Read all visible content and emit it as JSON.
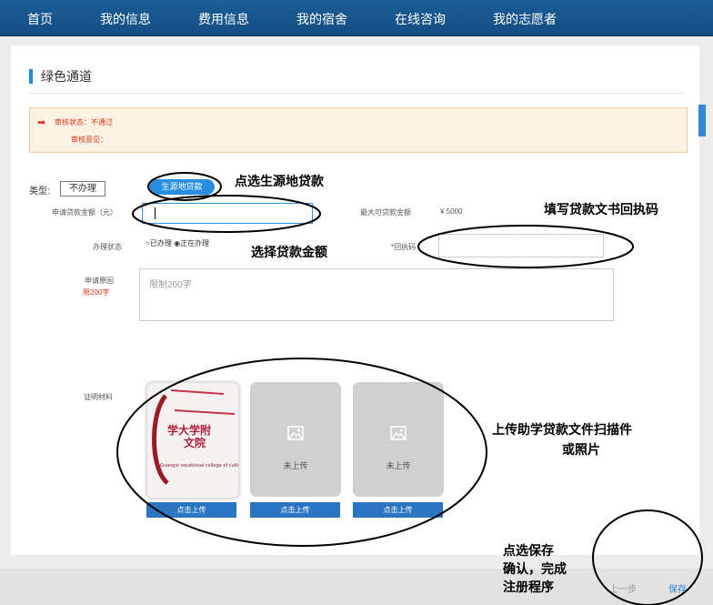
{
  "nav": {
    "items": [
      "首页",
      "我的信息",
      "费用信息",
      "我的宿舍",
      "在线咨询",
      "我的志愿者"
    ]
  },
  "section": {
    "title": "绿色通道"
  },
  "alert": {
    "status": "审核状态：不通过",
    "comment": "审核意见："
  },
  "form": {
    "type_label": "类型:",
    "type_not_handled": "不办理",
    "type_loan": "生源地贷款",
    "amount_label": "申请贷款金额（元）",
    "amount_value": "",
    "max_label": "最大可贷款金额",
    "max_value": "¥ 5000",
    "status_label": "办理状态",
    "status_option_done": "已办理",
    "status_option_in_progress": "正在办理",
    "status_selected": "正在办理",
    "receipt_label": "*回执码",
    "receipt_value": "",
    "reason_label": "申请原因",
    "reason_limit": "限200字",
    "reason_placeholder": "限制200字",
    "materials_label": "证明材料"
  },
  "uploads": [
    {
      "state": "已上传",
      "caption": "",
      "button": "点击上传"
    },
    {
      "state": "empty",
      "caption": "未上传",
      "button": "点击上传"
    },
    {
      "state": "empty",
      "caption": "未上传",
      "button": "点击上传"
    }
  ],
  "footer": {
    "prev": "上一步",
    "save": "保存"
  },
  "annotations": {
    "select_loan": "点选生源地贷款",
    "fill_receipt": "填写贷款文书回执码",
    "select_amount": "选择贷款金额",
    "upload_line1": "上传助学贷款文件扫描件",
    "upload_line2": "或照片",
    "save_line1": "点选保存",
    "save_line2": "确认，完成",
    "save_line3": "注册程序"
  },
  "colors": {
    "nav_bg": "#1b5d96",
    "accent": "#2a8ee0",
    "alert_bg": "#fdf3e5",
    "alert_text": "#e0311c"
  }
}
